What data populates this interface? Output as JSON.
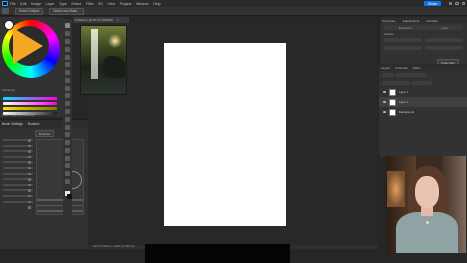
{
  "menubar": {
    "items": [
      "File",
      "Edit",
      "Image",
      "Layer",
      "Type",
      "Select",
      "Filter",
      "3D",
      "View",
      "Plugins",
      "Window",
      "Help"
    ],
    "share_label": "Share"
  },
  "optionsbar": {
    "chip1": "Select Subject",
    "chip2": "Select and Mask..."
  },
  "document": {
    "tab_label": "Untitled-1 @ 66.7% (RGB/8)",
    "close_glyph": "×"
  },
  "left_panel": {
    "swatches_label": "Swatches",
    "tabs_label": "Color  Swatches  Gradients"
  },
  "brush_settings": {
    "tabs": [
      "Brush Settings",
      "Brushes"
    ],
    "brushes_button": "Brushes"
  },
  "properties": {
    "tabs": [
      "Properties",
      "Adjustments",
      "Libraries"
    ],
    "sub_tabs": [
      "Document",
      "Layer"
    ],
    "canvas_label": "Canvas",
    "button": "Image Size"
  },
  "layers": {
    "tabs": [
      "Layers",
      "Channels",
      "Paths"
    ],
    "rows": [
      {
        "name": "Layer 1",
        "selected": false
      },
      {
        "name": "Layer 1",
        "selected": true
      },
      {
        "name": "Background",
        "selected": false
      }
    ]
  },
  "status": {
    "zoom_text": "66.67%   3000 px x 4000 px (300 ppi)"
  },
  "colors": {
    "accent": "#1473e6",
    "panel": "#323232",
    "workspace": "#262626"
  },
  "icons": [
    "ps-logo-icon",
    "search-icon",
    "user-icon",
    "settings-icon"
  ]
}
